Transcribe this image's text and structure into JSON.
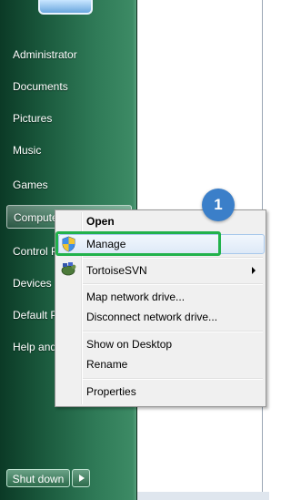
{
  "start_menu": {
    "items": [
      {
        "label": "Administrator"
      },
      {
        "label": "Documents"
      },
      {
        "label": "Pictures"
      },
      {
        "label": "Music"
      },
      {
        "label": "Games"
      },
      {
        "label": "Computer"
      },
      {
        "label": "Control Panel"
      },
      {
        "label": "Devices and Printers"
      },
      {
        "label": "Default Programs"
      },
      {
        "label": "Help and Support"
      }
    ],
    "shutdown_label": "Shut down"
  },
  "context_menu": {
    "open": "Open",
    "manage": "Manage",
    "tortoisesvn": "TortoiseSVN",
    "map_drive": "Map network drive...",
    "disconnect_drive": "Disconnect network drive...",
    "show_desktop": "Show on Desktop",
    "rename": "Rename",
    "properties": "Properties"
  },
  "annotation": {
    "step_number": "1",
    "highlight_color": "#22b24c",
    "badge_color": "#3b7fc9"
  },
  "icons": [
    "windows-logo",
    "uac-shield",
    "tortoisesvn-turtle",
    "submenu-arrow",
    "shutdown-arrow"
  ]
}
